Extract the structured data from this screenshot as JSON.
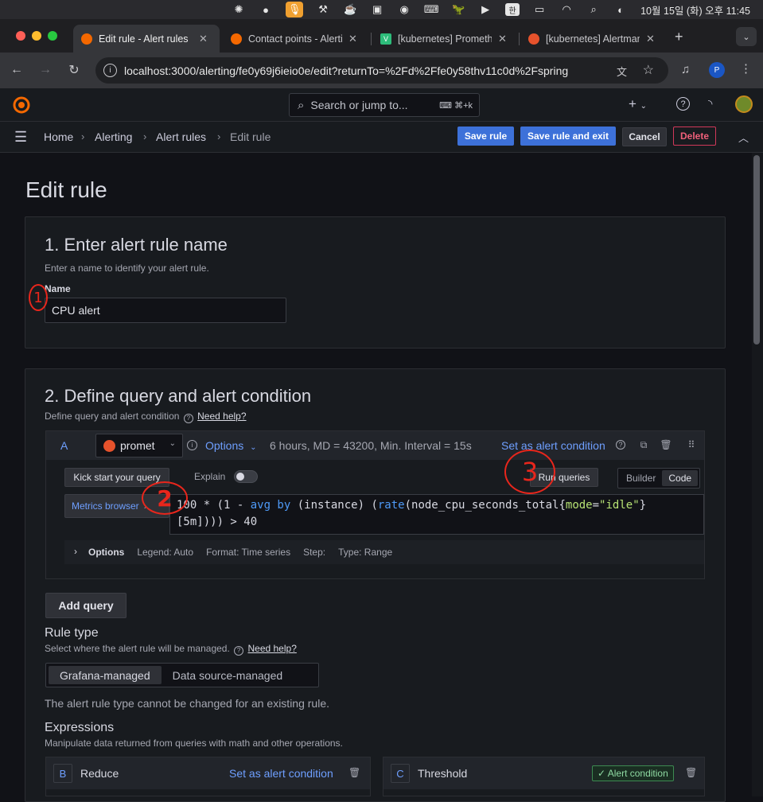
{
  "menubar": {
    "datetime": "10월 15일 (화) 오후 11:45",
    "input_lang": "한"
  },
  "browser": {
    "tabs": [
      {
        "title": "Edit rule - Alert rules",
        "active": true
      },
      {
        "title": "Contact points - Alerting",
        "active": false
      },
      {
        "title": "[kubernetes] Prometheus",
        "active": false
      },
      {
        "title": "[kubernetes] Alertmanager",
        "active": false
      }
    ],
    "url": "localhost:3000/alerting/fe0y69j6ieio0e/edit?returnTo=%2Fd%2Ffe0y58thv11c0d%2Fspring",
    "profile_initial": "P"
  },
  "grafana": {
    "search_placeholder": "Search or jump to...",
    "search_shortcut": "⌘+k",
    "breadcrumb": [
      "Home",
      "Alerting",
      "Alert rules",
      "Edit rule"
    ],
    "actions": {
      "save": "Save rule",
      "save_exit": "Save rule and exit",
      "cancel": "Cancel",
      "delete": "Delete"
    }
  },
  "page": {
    "title": "Edit rule",
    "section1": {
      "title": "1. Enter alert rule name",
      "desc": "Enter a name to identify your alert rule.",
      "name_label": "Name",
      "name_value": "CPU alert"
    },
    "section2": {
      "title": "2. Define query and alert condition",
      "desc": "Define query and alert condition",
      "help": "Need help?",
      "query": {
        "ref": "A",
        "datasource": "promet",
        "options_label": "Options",
        "options_summary": "6 hours, MD = 43200, Min. Interval = 15s",
        "set_condition": "Set as alert condition",
        "kick_start": "Kick start your query",
        "explain": "Explain",
        "run_queries": "Run queries",
        "mode_builder": "Builder",
        "mode_code": "Code",
        "metrics_browser": "Metrics browser",
        "expr_line1_a": "100 * (1 - ",
        "expr_fn1": "avg by",
        "expr_line1_b": " (instance) (",
        "expr_fn2": "rate",
        "expr_line1_c": "(node_cpu_seconds_total{",
        "expr_label": "mode",
        "expr_eq": "=",
        "expr_str": "\"idle\"",
        "expr_line1_d": "}",
        "expr_line2": "[5m]))) > 40",
        "opt_title": "Options",
        "opt_legend": "Legend: Auto",
        "opt_format": "Format: Time series",
        "opt_step": "Step:",
        "opt_type": "Type: Range"
      },
      "add_query": "Add query",
      "rule_type": {
        "title": "Rule type",
        "desc": "Select where the alert rule will be managed.",
        "help": "Need help?",
        "opt_grafana": "Grafana-managed",
        "opt_ds": "Data source-managed",
        "note": "The alert rule type cannot be changed for an existing rule."
      },
      "expressions": {
        "title": "Expressions",
        "desc": "Manipulate data returned from queries with math and other operations.",
        "items": [
          {
            "ref": "B",
            "name": "Reduce",
            "action": "Set as alert condition"
          },
          {
            "ref": "C",
            "name": "Threshold",
            "badge": "✓ Alert condition"
          }
        ]
      }
    },
    "annotations": [
      "1",
      "2",
      "3"
    ]
  }
}
